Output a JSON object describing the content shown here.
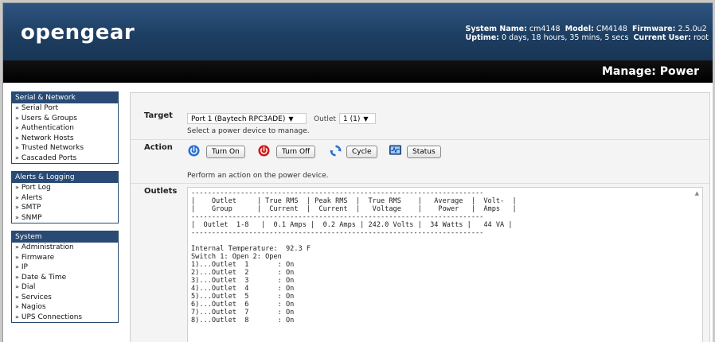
{
  "header": {
    "logo": "opengear",
    "system_name_label": "System Name:",
    "system_name": "cm4148",
    "model_label": "Model:",
    "model": "CM4148",
    "firmware_label": "Firmware:",
    "firmware": "2.5.0u2",
    "uptime_label": "Uptime:",
    "uptime": "0 days, 18 hours, 35 mins, 5 secs",
    "user_label": "Current User:",
    "user": "root"
  },
  "page_title": "Manage: Power",
  "sidebar": {
    "sections": [
      {
        "title": "Serial & Network",
        "items": [
          "Serial Port",
          "Users & Groups",
          "Authentication",
          "Network Hosts",
          "Trusted Networks",
          "Cascaded Ports"
        ]
      },
      {
        "title": "Alerts & Logging",
        "items": [
          "Port Log",
          "Alerts",
          "SMTP",
          "SNMP"
        ]
      },
      {
        "title": "System",
        "items": [
          "Administration",
          "Firmware",
          "IP",
          "Date & Time",
          "Dial",
          "Services",
          "Nagios",
          "UPS Connections"
        ]
      }
    ]
  },
  "target": {
    "label": "Target",
    "device_select": "Port 1 (Baytech RPC3ADE)",
    "outlet_label": "Outlet",
    "outlet_select": "1 (1)",
    "help": "Select a power device to manage."
  },
  "action": {
    "label": "Action",
    "turn_on": "Turn On",
    "turn_off": "Turn Off",
    "cycle": "Cycle",
    "status": "Status",
    "help": "Perform an action on the power device."
  },
  "outlets": {
    "label": "Outlets",
    "console_lines": [
      "-----------------------------------------------------------------------",
      "|    Outlet     | True RMS  | Peak RMS  |  True RMS    |   Average  |  Volt-  |",
      "|    Group      |  Current  |  Current  |   Voltage    |    Power   |  Amps   |",
      "-----------------------------------------------------------------------",
      "|  Outlet  1-8   |  0.1 Amps |  0.2 Amps | 242.0 Volts |  34 Watts |   44 VA |",
      "-----------------------------------------------------------------------",
      "",
      "Internal Temperature:  92.3 F",
      "Switch 1: Open 2: Open",
      "1)...Outlet  1       : On",
      "2)...Outlet  2       : On",
      "3)...Outlet  3       : On",
      "4)...Outlet  4       : On",
      "5)...Outlet  5       : On",
      "6)...Outlet  6       : On",
      "7)...Outlet  7       : On",
      "8)...Outlet  8       : On"
    ]
  },
  "icons": {
    "power_on": "power-on-icon",
    "power_off": "power-off-icon",
    "cycle": "cycle-icon",
    "status": "status-monitor-icon"
  },
  "colors": {
    "header_blue": "#1d3d61",
    "nav_head": "#284a74",
    "on_blue": "#2a6fd0",
    "off_red": "#d01818"
  }
}
